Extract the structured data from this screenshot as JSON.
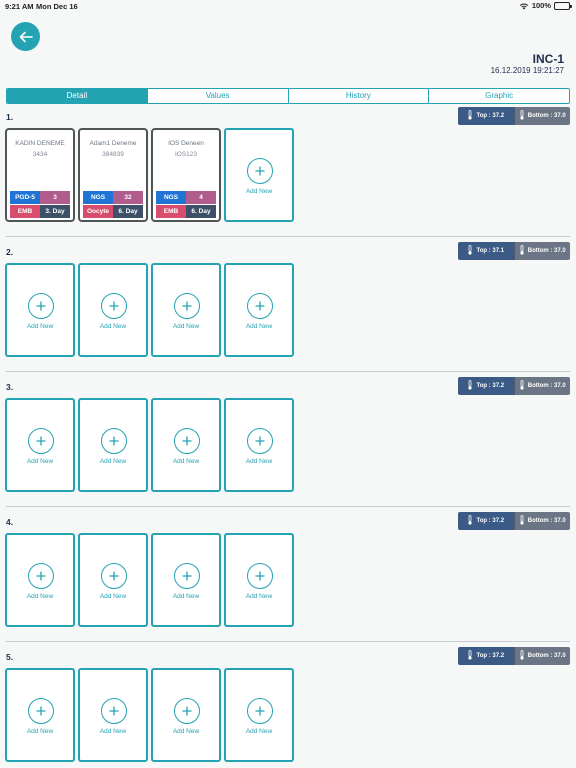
{
  "status": {
    "time": "9:21 AM",
    "date": "Mon Dec 16",
    "battery": "100%",
    "battery_level": 1.0
  },
  "header": {
    "title": "INC-1",
    "datetime": "16.12.2019 19:21:27"
  },
  "tabs": [
    {
      "label": "Detail",
      "active": true
    },
    {
      "label": "Values",
      "active": false
    },
    {
      "label": "History",
      "active": false
    },
    {
      "label": "Graphic",
      "active": false
    }
  ],
  "colors": {
    "accent": "#24a3b3",
    "navy": "#1d2e4f",
    "temp_top": "#3b5a85",
    "temp_bottom": "#6b7585"
  },
  "add_new_label": "Add New",
  "sections": [
    {
      "number": "1.",
      "temp_top": "Top : 37.2",
      "temp_bottom": "Bottom : 37.0",
      "cards": [
        {
          "filled": true,
          "name": "KADIN DENEME",
          "id": "3434",
          "tag1": "PGD-5",
          "val1": "3",
          "tag2": "EMB",
          "val2": "3. Day"
        },
        {
          "filled": true,
          "name": "Adam1 Deneme",
          "id": "384839",
          "tag1": "NGS",
          "val1": "32",
          "tag2": "Oocyte",
          "val2": "6. Day"
        },
        {
          "filled": true,
          "name": "IOS Deneen",
          "id": "IOS123",
          "tag1": "NGS",
          "val1": "4",
          "tag2": "EMB",
          "val2": "6. Day"
        },
        {
          "filled": false
        }
      ]
    },
    {
      "number": "2.",
      "temp_top": "Top : 37.1",
      "temp_bottom": "Bottom : 37.0",
      "cards": [
        {
          "filled": false
        },
        {
          "filled": false
        },
        {
          "filled": false
        },
        {
          "filled": false
        }
      ]
    },
    {
      "number": "3.",
      "temp_top": "Top : 37.2",
      "temp_bottom": "Bottom : 37.0",
      "cards": [
        {
          "filled": false
        },
        {
          "filled": false
        },
        {
          "filled": false
        },
        {
          "filled": false
        }
      ]
    },
    {
      "number": "4.",
      "temp_top": "Top : 37.2",
      "temp_bottom": "Bottom : 37.0",
      "cards": [
        {
          "filled": false
        },
        {
          "filled": false
        },
        {
          "filled": false
        },
        {
          "filled": false
        }
      ]
    },
    {
      "number": "5.",
      "temp_top": "Top : 37.2",
      "temp_bottom": "Bottom : 37.0",
      "cards": [
        {
          "filled": false
        },
        {
          "filled": false
        },
        {
          "filled": false
        },
        {
          "filled": false
        }
      ]
    }
  ]
}
